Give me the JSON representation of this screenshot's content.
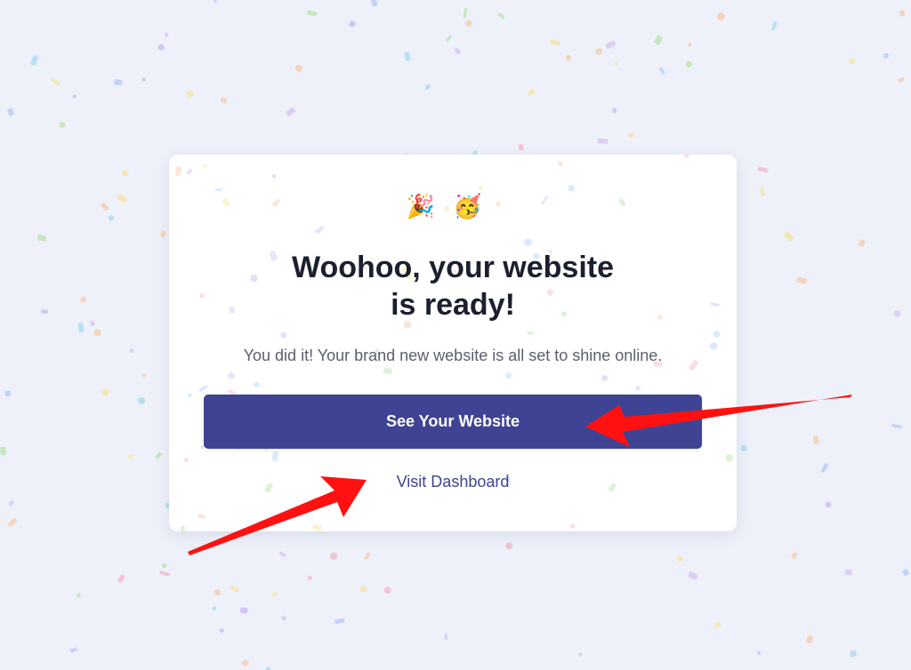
{
  "colors": {
    "page_background": "#eef1fa",
    "card_background": "#ffffff",
    "accent": "#3e4493",
    "title": "#1b1f2e",
    "subtitle": "#5a5f6e",
    "annotation_arrow": "#ff1111"
  },
  "celebration": {
    "icons": [
      "party-popper-icon",
      "partying-face-icon"
    ],
    "party_popper": "🎉",
    "partying_face": "🥳"
  },
  "card": {
    "title": "Woohoo, your website\nis ready!",
    "subtitle": "You did it! Your brand new website is all set to shine online.",
    "primary_button_label": "See Your Website",
    "secondary_link_label": "Visit Dashboard"
  }
}
